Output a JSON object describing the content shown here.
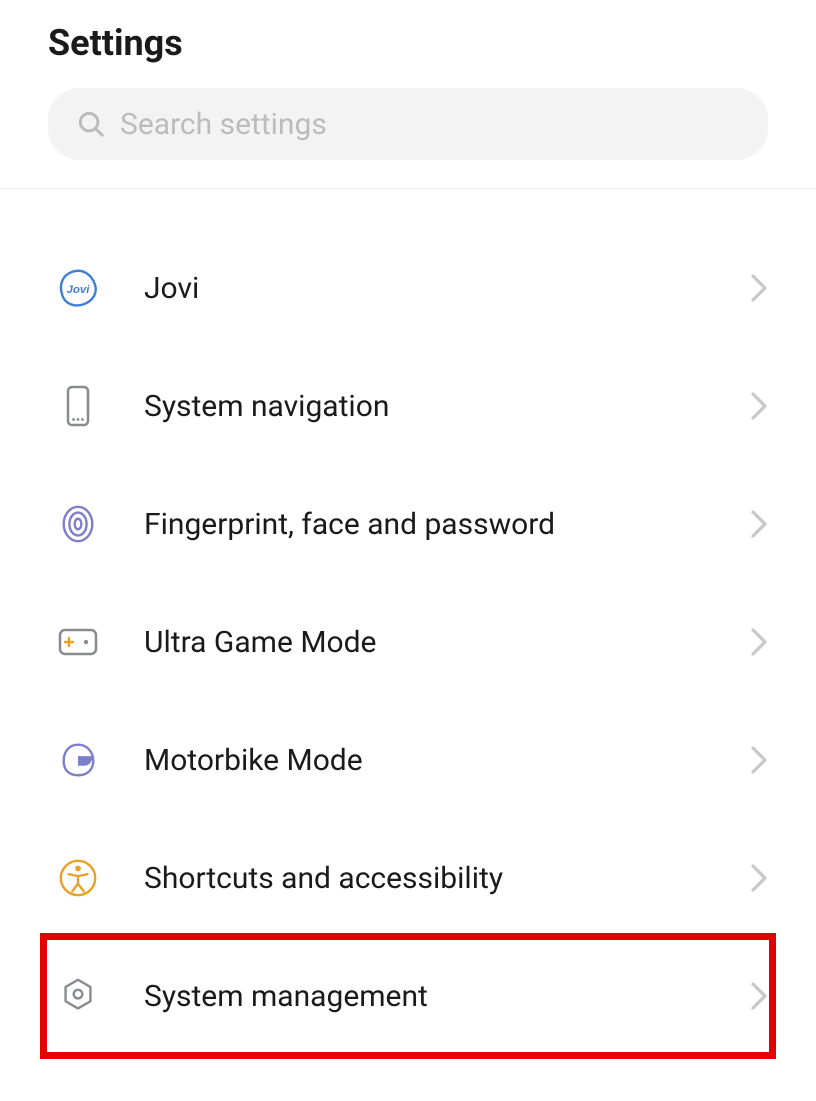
{
  "header": {
    "title": "Settings"
  },
  "search": {
    "placeholder": "Search settings"
  },
  "items": [
    {
      "label": "Jovi",
      "icon": "jovi-icon",
      "highlight": false
    },
    {
      "label": "System navigation",
      "icon": "phone-icon",
      "highlight": false
    },
    {
      "label": "Fingerprint, face and password",
      "icon": "fingerprint-icon",
      "highlight": false
    },
    {
      "label": "Ultra Game Mode",
      "icon": "gamepad-icon",
      "highlight": false
    },
    {
      "label": "Motorbike Mode",
      "icon": "helmet-icon",
      "highlight": false
    },
    {
      "label": "Shortcuts and accessibility",
      "icon": "accessibility-icon",
      "highlight": false
    },
    {
      "label": "System management",
      "icon": "gear-hex-icon",
      "highlight": true
    }
  ],
  "colors": {
    "highlight": "#e30000",
    "jovi": "#3f7fd6",
    "indigo": "#7d7fc7",
    "grey": "#888a90",
    "amber": "#e8a126"
  }
}
